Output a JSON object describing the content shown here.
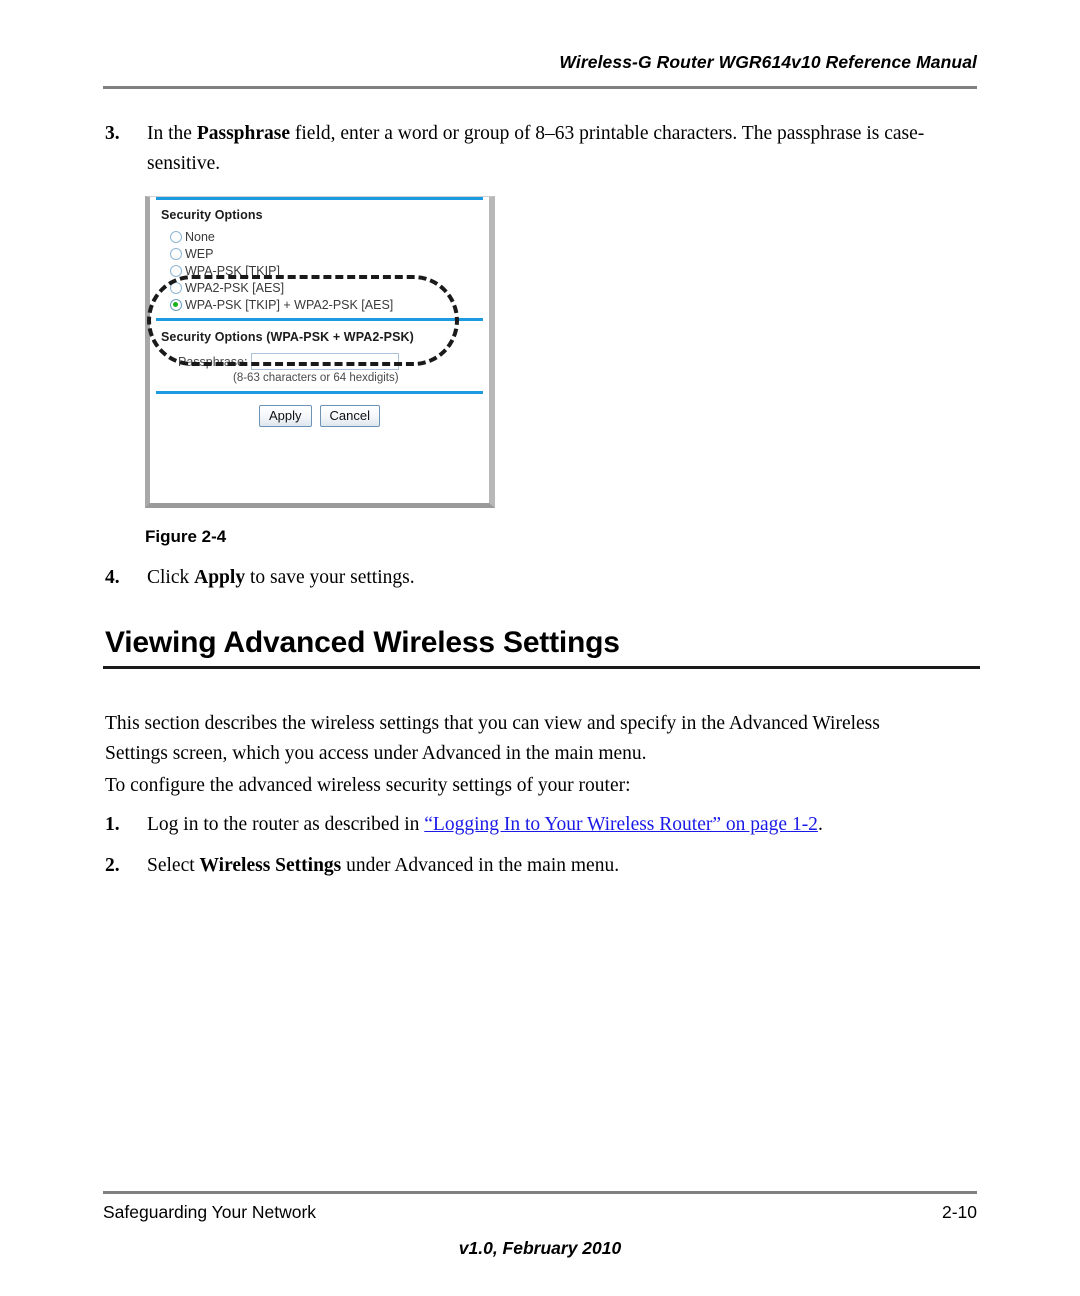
{
  "header": {
    "title": "Wireless-G Router WGR614v10 Reference Manual"
  },
  "steps": {
    "step3": {
      "number": "3.",
      "text_before": "In the ",
      "bold": "Passphrase",
      "text_after": " field, enter a word or group of 8–63 printable characters. The passphrase is case-sensitive."
    },
    "step4": {
      "number": "4.",
      "text_before": "Click ",
      "bold": "Apply",
      "text_after": " to save your settings."
    },
    "adv1": {
      "number": "1.",
      "text_before": "Log in to the router as described in ",
      "link": "“Logging In to Your Wireless Router” on page 1-2",
      "text_after": "."
    },
    "adv2": {
      "number": "2.",
      "text_before": "Select ",
      "bold": "Wireless Settings",
      "text_after": " under Advanced in the main menu."
    }
  },
  "figure": {
    "caption": "Figure 2-4",
    "screenshot": {
      "security_options_title": "Security Options",
      "radios": [
        {
          "label": "None",
          "selected": false
        },
        {
          "label": "WEP",
          "selected": false
        },
        {
          "label": "WPA-PSK [TKIP]",
          "selected": false
        },
        {
          "label": "WPA2-PSK [AES]",
          "selected": false
        },
        {
          "label": "WPA-PSK [TKIP] + WPA2-PSK [AES]",
          "selected": true
        }
      ],
      "passphrase_section_title": "Security Options (WPA-PSK + WPA2-PSK)",
      "passphrase_label": "Passphrase:",
      "passphrase_value": "",
      "passphrase_hint": "(8-63 characters or 64 hexdigits)",
      "apply_label": "Apply",
      "cancel_label": "Cancel",
      "accent_rule_color": "#1b9ae0",
      "selected_radio_color": "#19b319"
    }
  },
  "section": {
    "heading": "Viewing Advanced Wireless Settings",
    "para1": "This section describes the wireless settings that you can view and specify in the Advanced Wireless Settings screen, which you access under Advanced in the main menu.",
    "para2": "To configure the advanced wireless security settings of your router:"
  },
  "footer": {
    "chapter": "Safeguarding Your Network",
    "page": "2-10",
    "version": "v1.0, February 2010",
    "link_color": "#1a1ae6"
  }
}
